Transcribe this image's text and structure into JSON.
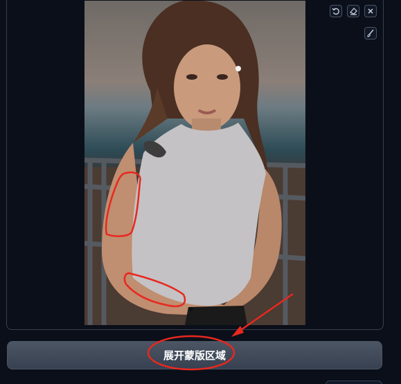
{
  "toolbar": {
    "undo_icon": "undo-icon",
    "eraser_icon": "eraser-icon",
    "close_icon": "close-icon",
    "brush_icon": "brush-icon"
  },
  "mask": {
    "expand_button_label": "展开蒙版区域"
  },
  "colors": {
    "background": "#0b0f19",
    "button": "#4b5563",
    "annotation": "#e8281f",
    "mask": "#c0bec0"
  }
}
